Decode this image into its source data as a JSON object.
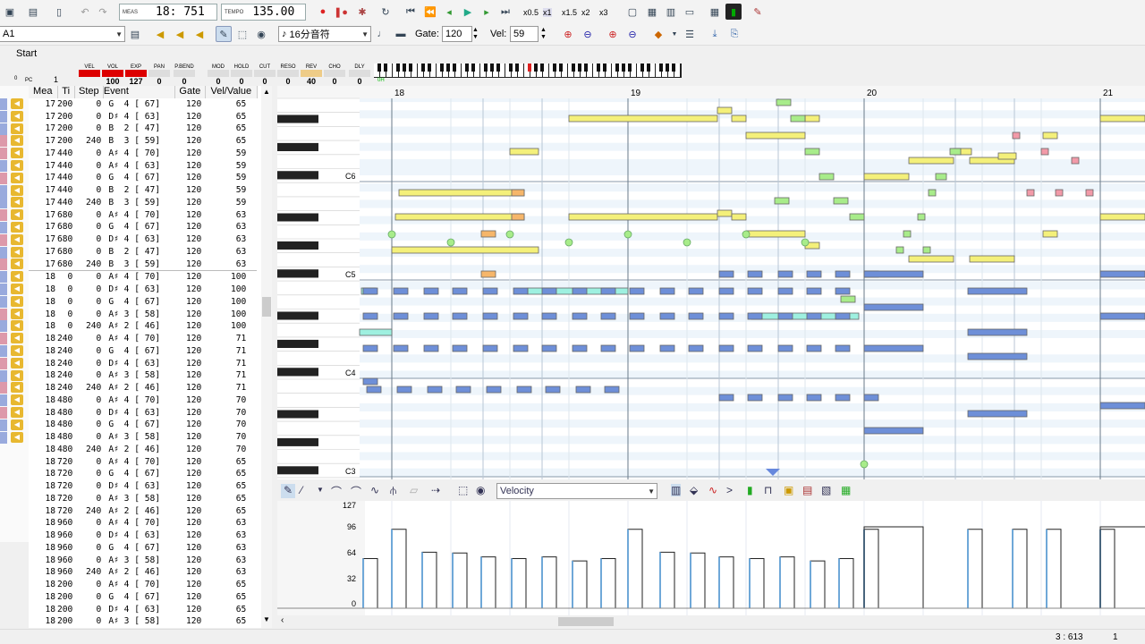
{
  "toolbar1": {
    "meas_label": "MEAS",
    "meas_value": "18: 751",
    "tempo_label": "TEMPO",
    "tempo_value": "135.00",
    "speed_options": [
      "x0.5",
      "x1",
      "x1.5",
      "x2",
      "x3"
    ]
  },
  "toolbar2": {
    "track_select": "A1",
    "note_length": "16分音符",
    "gate_label": "Gate:",
    "gate_value": "120",
    "vel_label": "Vel:",
    "vel_value": "59"
  },
  "start_label": "Start",
  "mixer": {
    "pc_label": "PC",
    "pc_prefix": "0",
    "pc_value": "1",
    "channels": [
      {
        "label": "VEL",
        "value": ""
      },
      {
        "label": "VOL",
        "value": "100"
      },
      {
        "label": "EXP",
        "value": "127"
      },
      {
        "label": "PAN",
        "value": "0"
      },
      {
        "label": "P.BEND",
        "value": "0"
      },
      {
        "label": "MOD",
        "value": "0"
      },
      {
        "label": "HOLD",
        "value": "0"
      },
      {
        "label": "CUT",
        "value": "0"
      },
      {
        "label": "RESO",
        "value": "0"
      },
      {
        "label": "REV",
        "value": "40"
      },
      {
        "label": "CHO",
        "value": "0"
      },
      {
        "label": "DLY",
        "value": "0"
      }
    ],
    "level_label": "0H"
  },
  "event_list": {
    "headers": [
      "Mea",
      "Ti",
      "Step",
      "Event",
      "Gate",
      "Vel/Value"
    ],
    "rows": [
      [
        "17",
        "200",
        "0",
        "G  4 [ 67]",
        "120",
        "65"
      ],
      [
        "17",
        "200",
        "0",
        "D♯ 4 [ 63]",
        "120",
        "65"
      ],
      [
        "17",
        "200",
        "0",
        "B  2 [ 47]",
        "120",
        "65"
      ],
      [
        "17",
        "200",
        "240",
        "B  3 [ 59]",
        "120",
        "65"
      ],
      [
        "17",
        "440",
        "0",
        "A♯ 4 [ 70]",
        "120",
        "59"
      ],
      [
        "17",
        "440",
        "0",
        "A♯ 4 [ 63]",
        "120",
        "59"
      ],
      [
        "17",
        "440",
        "0",
        "G  4 [ 67]",
        "120",
        "59"
      ],
      [
        "17",
        "440",
        "0",
        "B  2 [ 47]",
        "120",
        "59"
      ],
      [
        "17",
        "440",
        "240",
        "B  3 [ 59]",
        "120",
        "59"
      ],
      [
        "17",
        "680",
        "0",
        "A♯ 4 [ 70]",
        "120",
        "63"
      ],
      [
        "17",
        "680",
        "0",
        "G  4 [ 67]",
        "120",
        "63"
      ],
      [
        "17",
        "680",
        "0",
        "D♯ 4 [ 63]",
        "120",
        "63"
      ],
      [
        "17",
        "680",
        "0",
        "B  2 [ 47]",
        "120",
        "63"
      ],
      [
        "17",
        "680",
        "240",
        "B  3 [ 59]",
        "120",
        "63"
      ],
      [
        "18",
        "0",
        "0",
        "A♯ 4 [ 70]",
        "120",
        "100"
      ],
      [
        "18",
        "0",
        "0",
        "D♯ 4 [ 63]",
        "120",
        "100"
      ],
      [
        "18",
        "0",
        "0",
        "G  4 [ 67]",
        "120",
        "100"
      ],
      [
        "18",
        "0",
        "0",
        "A♯ 3 [ 58]",
        "120",
        "100"
      ],
      [
        "18",
        "0",
        "240",
        "A♯ 2 [ 46]",
        "120",
        "100"
      ],
      [
        "18",
        "240",
        "0",
        "A♯ 4 [ 70]",
        "120",
        "71"
      ],
      [
        "18",
        "240",
        "0",
        "G  4 [ 67]",
        "120",
        "71"
      ],
      [
        "18",
        "240",
        "0",
        "D♯ 4 [ 63]",
        "120",
        "71"
      ],
      [
        "18",
        "240",
        "0",
        "A♯ 3 [ 58]",
        "120",
        "71"
      ],
      [
        "18",
        "240",
        "240",
        "A♯ 2 [ 46]",
        "120",
        "71"
      ],
      [
        "18",
        "480",
        "0",
        "A♯ 4 [ 70]",
        "120",
        "70"
      ],
      [
        "18",
        "480",
        "0",
        "D♯ 4 [ 63]",
        "120",
        "70"
      ],
      [
        "18",
        "480",
        "0",
        "G  4 [ 67]",
        "120",
        "70"
      ],
      [
        "18",
        "480",
        "0",
        "A♯ 3 [ 58]",
        "120",
        "70"
      ],
      [
        "18",
        "480",
        "240",
        "A♯ 2 [ 46]",
        "120",
        "70"
      ],
      [
        "18",
        "720",
        "0",
        "A♯ 4 [ 70]",
        "120",
        "65"
      ],
      [
        "18",
        "720",
        "0",
        "G  4 [ 67]",
        "120",
        "65"
      ],
      [
        "18",
        "720",
        "0",
        "D♯ 4 [ 63]",
        "120",
        "65"
      ],
      [
        "18",
        "720",
        "0",
        "A♯ 3 [ 58]",
        "120",
        "65"
      ],
      [
        "18",
        "720",
        "240",
        "A♯ 2 [ 46]",
        "120",
        "65"
      ],
      [
        "18",
        "960",
        "0",
        "A♯ 4 [ 70]",
        "120",
        "63"
      ],
      [
        "18",
        "960",
        "0",
        "D♯ 4 [ 63]",
        "120",
        "63"
      ],
      [
        "18",
        "960",
        "0",
        "G  4 [ 67]",
        "120",
        "63"
      ],
      [
        "18",
        "960",
        "0",
        "A♯ 3 [ 58]",
        "120",
        "63"
      ],
      [
        "18",
        "960",
        "240",
        "A♯ 2 [ 46]",
        "120",
        "63"
      ],
      [
        "18",
        "200",
        "0",
        "A♯ 4 [ 70]",
        "120",
        "65"
      ],
      [
        "18",
        "200",
        "0",
        "G  4 [ 67]",
        "120",
        "65"
      ],
      [
        "18",
        "200",
        "0",
        "D♯ 4 [ 63]",
        "120",
        "65"
      ],
      [
        "18",
        "200",
        "0",
        "A♯ 3 [ 58]",
        "120",
        "65"
      ]
    ]
  },
  "piano_roll": {
    "measures": [
      "18",
      "19",
      "20",
      "21"
    ],
    "octave_labels": [
      "C6",
      "C5",
      "C4",
      "C3"
    ]
  },
  "velocity_panel": {
    "controller_select": "Velocity",
    "scale_labels": [
      "127",
      "96",
      "64",
      "32",
      "0"
    ]
  },
  "status": {
    "position": "3 : 613",
    "page": "1"
  },
  "colors": {
    "yellow_note": "#f4f07a",
    "blue_note": "#6e8fd8",
    "green_note": "#a8ec8a",
    "pink_note": "#f29aa8",
    "cyan_note": "#9ef0e0",
    "orange_note": "#f6b66a"
  }
}
